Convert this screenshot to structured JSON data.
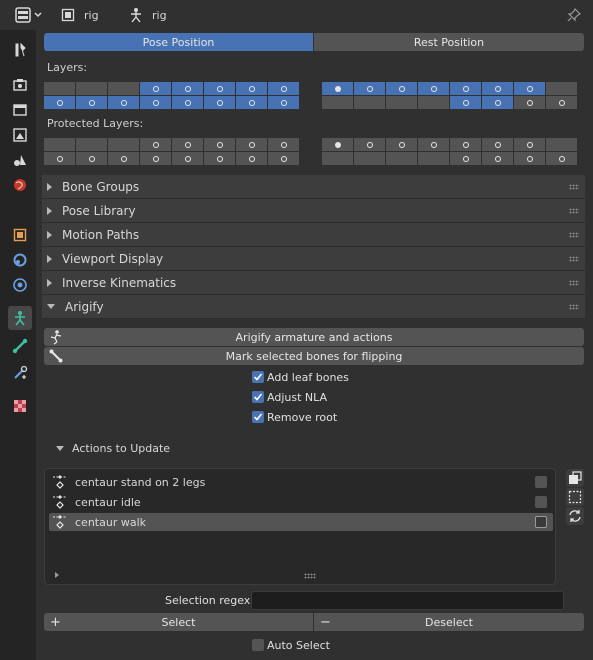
{
  "header": {
    "object_name": "rig",
    "armature_name": "rig",
    "icons": [
      "editor-type-icon",
      "object-icon",
      "armature-data-icon",
      "pin-icon"
    ]
  },
  "tabs": [
    "tool-icon",
    "render-icon",
    "output-icon",
    "view-layer-icon",
    "scene-icon",
    "world-icon",
    "object-icon",
    "modifier-icon",
    "physics-icon",
    "armature-data-icon",
    "bone-icon",
    "bone-constraint-icon",
    "texture-icon"
  ],
  "position": {
    "pose_label": "Pose Position",
    "rest_label": "Rest Position",
    "active": "pose"
  },
  "layers": {
    "label": "Layers:",
    "protected_label": "Protected Layers:",
    "layers_on": [
      3,
      4,
      5,
      6,
      7,
      8,
      9,
      10,
      11,
      12,
      13,
      14,
      15,
      16,
      17,
      18,
      19,
      20,
      21,
      22,
      28,
      29
    ],
    "layers_active": 16,
    "layers_content": [
      3,
      4,
      5,
      6,
      7,
      8,
      9,
      10,
      11,
      12,
      13,
      14,
      15,
      16,
      17,
      18,
      19,
      20,
      21,
      22,
      28,
      29,
      30,
      31
    ],
    "protected_content": [
      3,
      4,
      5,
      6,
      7,
      8,
      9,
      10,
      11,
      12,
      13,
      14,
      15,
      16,
      17,
      18,
      19,
      20,
      21,
      22,
      28,
      29,
      30,
      31
    ],
    "protected_active": 16
  },
  "subpanels": [
    "Bone Groups",
    "Pose Library",
    "Motion Paths",
    "Viewport Display",
    "Inverse Kinematics"
  ],
  "arigify": {
    "title": "Arigify",
    "btn_armature": "Arigify armature and actions",
    "btn_flip": "Mark selected bones for flipping",
    "options": [
      {
        "label": "Add leaf bones",
        "checked": true
      },
      {
        "label": "Adjust NLA",
        "checked": true
      },
      {
        "label": "Remove root",
        "checked": true
      }
    ],
    "actions_title": "Actions to Update",
    "actions": [
      {
        "label": "centaur stand on 2 legs",
        "checked": false,
        "selected": false
      },
      {
        "label": "centaur idle",
        "checked": false,
        "selected": false
      },
      {
        "label": "centaur walk",
        "checked": false,
        "selected": true
      }
    ],
    "regex_label": "Selection regex",
    "regex_value": "",
    "select_label": "Select",
    "deselect_label": "Deselect",
    "auto_select_label": "Auto Select",
    "auto_select_checked": false
  }
}
